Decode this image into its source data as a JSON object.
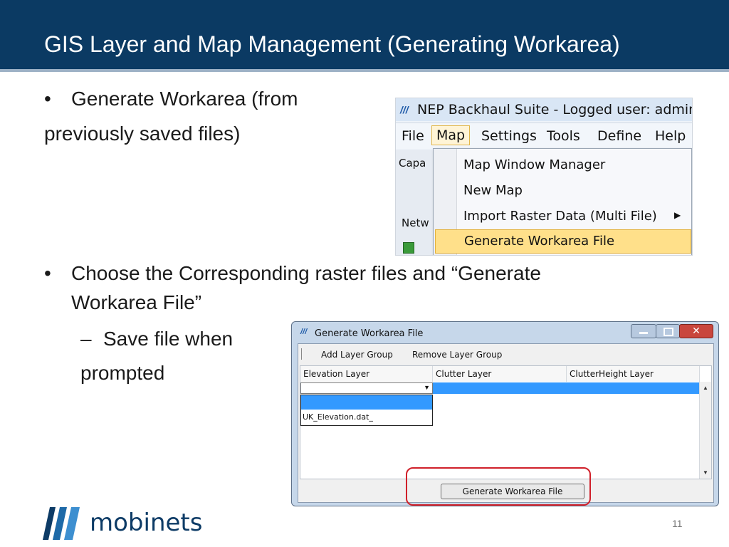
{
  "slide": {
    "title": "GIS Layer and Map Management (Generating Workarea)",
    "page_number": "11"
  },
  "bullets": {
    "b1_line1": "Generate Workarea (from",
    "b1_line2": "previously saved files)",
    "b2_line1": "Choose the Corresponding raster files and “Generate",
    "b2_line2": "Workarea File”",
    "sub_line1": "Save file when",
    "sub_line2": "prompted"
  },
  "screenshot1": {
    "window_title": "NEP Backhaul Suite - Logged user: admin",
    "menus": [
      "File",
      "Map",
      "Settings",
      "Tools",
      "Define",
      "Help"
    ],
    "left_fragments": [
      "Capa",
      "Netw"
    ],
    "dropdown_items": [
      "Map Window Manager",
      "New Map",
      "Import Raster Data (Multi File)",
      "Generate Workarea File"
    ]
  },
  "screenshot2": {
    "window_title": "Generate Workarea File",
    "toolbar": {
      "add_group": "Add Layer Group",
      "remove_group": "Remove Layer Group"
    },
    "columns": [
      "Elevation Layer",
      "Clutter Layer",
      "ClutterHeight Layer"
    ],
    "dropdown_option": "UK_Elevation.dat_",
    "button": "Generate Workarea File"
  },
  "logo": {
    "text": "mobinets"
  },
  "colors": {
    "header_bg": "#0b3a63",
    "highlight": "#ffe08a",
    "selection": "#3399ff",
    "callout": "#d0202a"
  }
}
